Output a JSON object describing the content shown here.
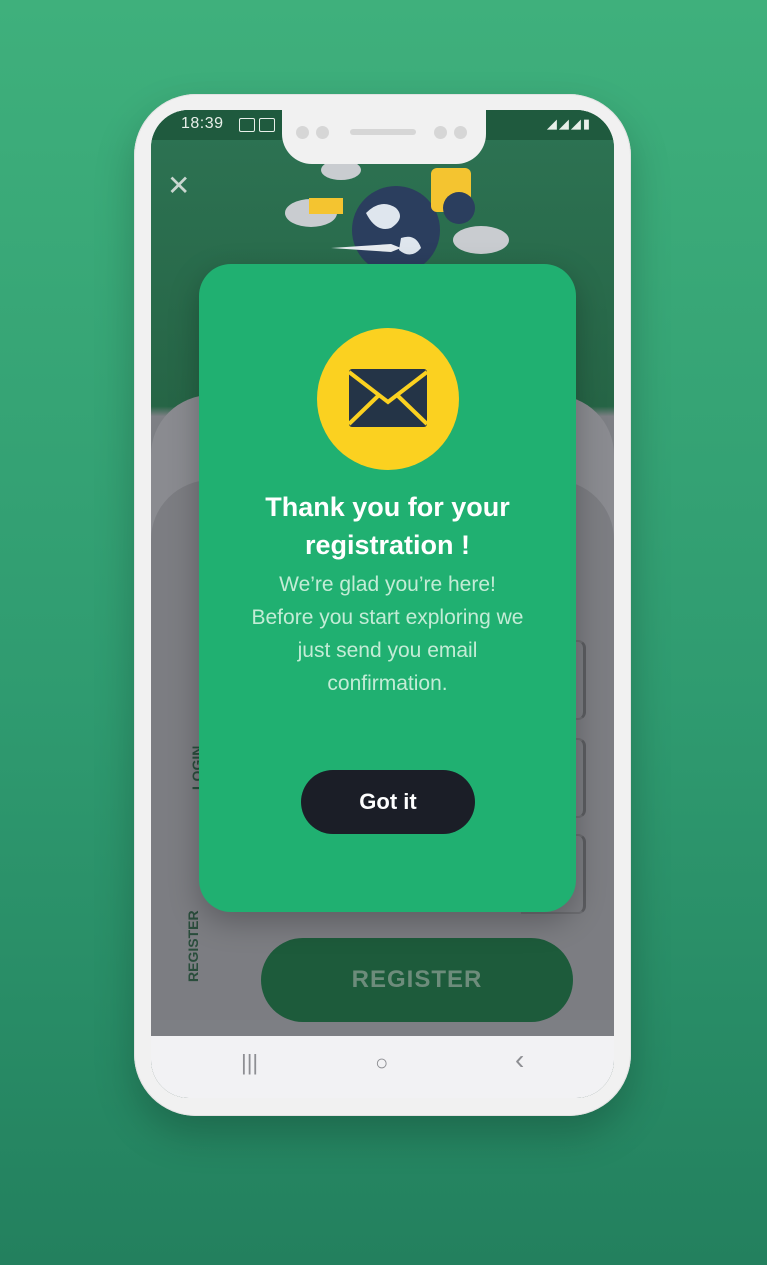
{
  "status_bar": {
    "time": "18:39"
  },
  "background": {
    "login_tab": "LOGIN",
    "register_tab": "REGISTER",
    "register_button": "REGISTER"
  },
  "modal": {
    "icon": "envelope-icon",
    "title": "Thank you for your registration !",
    "message": "We’re glad you’re here! Before you start exploring we just send you email confirmation.",
    "button": "Got it"
  },
  "nav_bar": {
    "recent": "|||",
    "home": "○",
    "back": "‹"
  },
  "colors": {
    "modal": "#20b071",
    "accent": "#fbd120",
    "button": "#1b1e27"
  }
}
